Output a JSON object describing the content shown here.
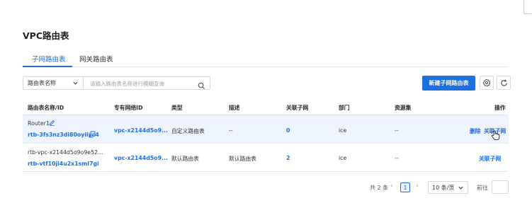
{
  "page": {
    "title": "VPC路由表"
  },
  "tabs": [
    {
      "label": "子网路由表",
      "active": true
    },
    {
      "label": "网关路由表",
      "active": false
    }
  ],
  "filter": {
    "field_value": "路由表名称",
    "search_placeholder": "请输入路由表名称进行模糊查询"
  },
  "toolbar": {
    "create_label": "新建子网路由表"
  },
  "table": {
    "columns": [
      "路由表名称/ID",
      "专有网络ID",
      "类型",
      "描述",
      "关联子网",
      "部门",
      "资源集",
      "操作"
    ],
    "rows": [
      {
        "name": "Router1",
        "id": "rtb-3fs3nz3di80oyiiyc4",
        "vpc": "vpc-x2144d5o9...",
        "type": "自定义路由表",
        "desc": "--",
        "subnets": "0",
        "dept": "ice",
        "resource_set": "--",
        "action_delete": "删除",
        "action_assoc": "关联子网"
      },
      {
        "name": "rtb-vpc-x2144d5o9o9e52...",
        "id": "rtb-vtf10ji4u2x1sml7gi",
        "vpc": "vpc-x2144d5o9...",
        "type": "默认路由表",
        "desc": "默认路由表",
        "subnets": "2",
        "dept": "ice",
        "resource_set": "--",
        "action_assoc": "关联子网"
      }
    ]
  },
  "pagination": {
    "total_text": "共 2 条",
    "current_page": "1",
    "page_size": "10 条/页",
    "goto_label": "前往"
  },
  "colors": {
    "accent": "#1e6fe0",
    "row_highlight": "#eef4fd"
  }
}
